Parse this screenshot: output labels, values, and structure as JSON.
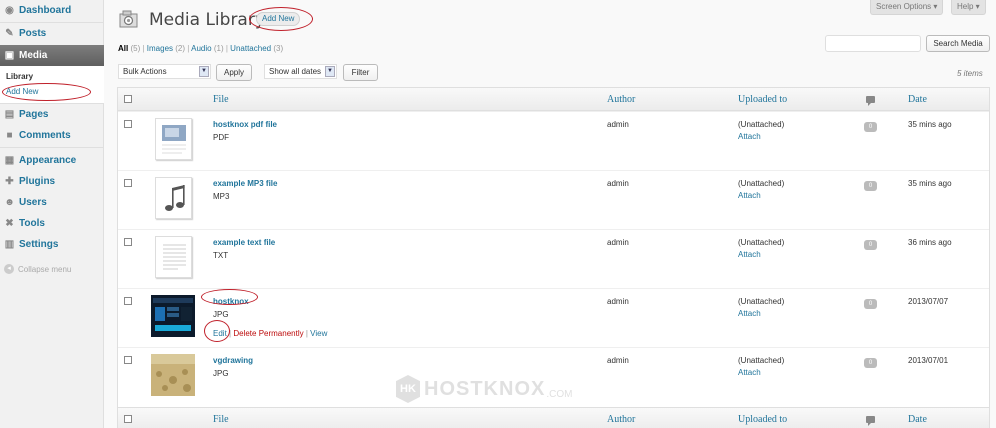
{
  "sidebar": {
    "items": [
      {
        "label": "Dashboard",
        "icon": "dashboard-icon"
      },
      {
        "label": "Posts",
        "icon": "pushpin-icon"
      },
      {
        "label": "Media",
        "icon": "media-icon"
      },
      {
        "label": "Pages",
        "icon": "page-icon"
      },
      {
        "label": "Comments",
        "icon": "comment-icon"
      },
      {
        "label": "Appearance",
        "icon": "appearance-icon"
      },
      {
        "label": "Plugins",
        "icon": "plugin-icon"
      },
      {
        "label": "Users",
        "icon": "users-icon"
      },
      {
        "label": "Tools",
        "icon": "tools-icon"
      },
      {
        "label": "Settings",
        "icon": "settings-icon"
      }
    ],
    "submenu": {
      "library": "Library",
      "add_new": "Add New"
    },
    "collapse": "Collapse menu"
  },
  "header": {
    "title": "Media Library",
    "add_new": "Add New",
    "screen_options": "Screen Options ▾",
    "help": "Help ▾"
  },
  "filters": {
    "all": "All",
    "all_count": "(5)",
    "images": "Images",
    "images_count": "(2)",
    "audio": "Audio",
    "audio_count": "(1)",
    "unattached": "Unattached",
    "unattached_count": "(3)"
  },
  "search": {
    "button": "Search Media",
    "value": ""
  },
  "tablenav": {
    "bulk_action": "Bulk Actions",
    "apply": "Apply",
    "date_filter": "Show all dates",
    "filter": "Filter",
    "items_count": "5 items"
  },
  "columns": {
    "file": "File",
    "author": "Author",
    "uploaded_to": "Uploaded to",
    "date": "Date"
  },
  "rows": [
    {
      "title": "hostknox pdf file",
      "ext": "PDF",
      "author": "admin",
      "uploaded": "(Unattached)",
      "attach": "Attach",
      "comments": "0",
      "date": "35 mins ago"
    },
    {
      "title": "example MP3 file",
      "ext": "MP3",
      "author": "admin",
      "uploaded": "(Unattached)",
      "attach": "Attach",
      "comments": "0",
      "date": "35 mins ago"
    },
    {
      "title": "example text file",
      "ext": "TXT",
      "author": "admin",
      "uploaded": "(Unattached)",
      "attach": "Attach",
      "comments": "0",
      "date": "36 mins ago"
    },
    {
      "title": "hostknox",
      "ext": "JPG",
      "author": "admin",
      "uploaded": "(Unattached)",
      "attach": "Attach",
      "comments": "0",
      "date": "2013/07/07",
      "actions": {
        "edit": "Edit",
        "delete": "Delete Permanently",
        "sep": "|",
        "view": "View"
      }
    },
    {
      "title": "vgdrawing",
      "ext": "JPG",
      "author": "admin",
      "uploaded": "(Unattached)",
      "attach": "Attach",
      "comments": "0",
      "date": "2013/07/01"
    }
  ],
  "watermark": {
    "badge": "HK",
    "brand": "HOSTKNOX",
    "suffix": ".COM"
  },
  "colors": {
    "link": "#21759b",
    "annotation": "#c0212b",
    "delete": "#bc0b0b"
  }
}
